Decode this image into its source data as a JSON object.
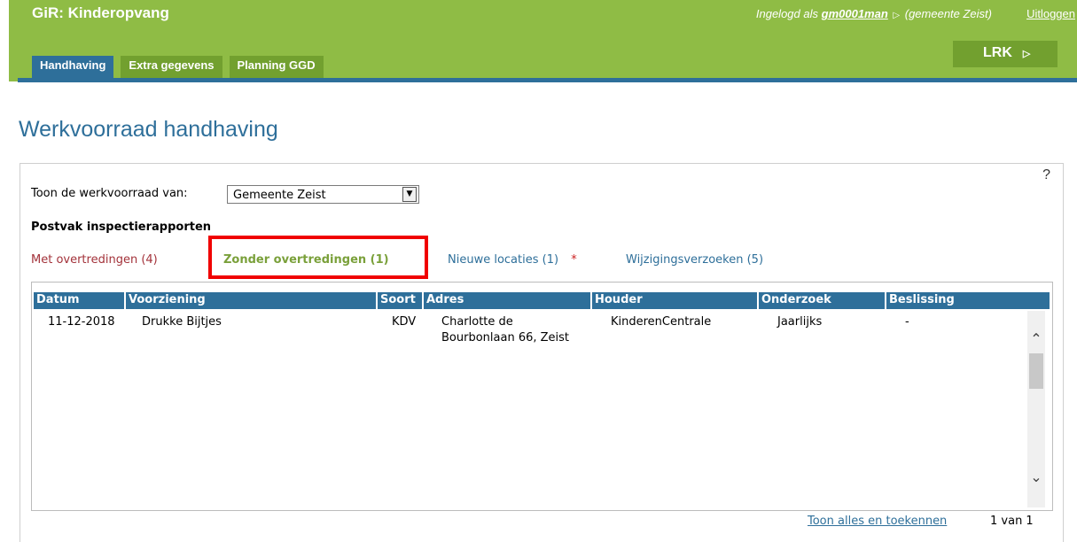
{
  "header": {
    "app_title": "GiR: Kinderopvang",
    "login_prefix": "Ingelogd als",
    "username": "gm0001man",
    "municipality": "(gemeente Zeist)",
    "logout_label": "Uitloggen",
    "lrk_label": "LRK",
    "colors": {
      "header_bg": "#8fbc45",
      "tab_bg": "#72a02f",
      "active_tab_bg": "#2e6f9a"
    }
  },
  "tabs": [
    {
      "label": "Handhaving",
      "active": true
    },
    {
      "label": "Extra gegevens",
      "active": false
    },
    {
      "label": "Planning GGD",
      "active": false
    }
  ],
  "page": {
    "title": "Werkvoorraad handhaving",
    "help_label": "?",
    "filter_label": "Toon de werkvoorraad van:",
    "filter_value": "Gemeente Zeist",
    "postvak_title": "Postvak inspectierapporten"
  },
  "subtabs": {
    "met": "Met overtredingen (4)",
    "zonder": "Zonder overtredingen (1)",
    "nieuw": "Nieuwe locaties (1)",
    "nieuw_star": "*",
    "wijz": "Wijzigingsverzoeken (5)"
  },
  "table": {
    "headers": [
      "Datum",
      "Voorziening",
      "Soort",
      "Adres",
      "Houder",
      "Onderzoek",
      "Beslissing"
    ],
    "rows": [
      {
        "datum": "11-12-2018",
        "voorziening": "Drukke Bijtjes",
        "soort": "KDV",
        "adres_line1": "Charlotte de",
        "adres_line2": "Bourbonlaan 66, Zeist",
        "houder": "KinderenCentrale",
        "onderzoek": "Jaarlijks",
        "beslissing": "-"
      }
    ]
  },
  "footer": {
    "toon_alles_label": "Toon alles en toekennen",
    "paging": "1  van 1"
  }
}
